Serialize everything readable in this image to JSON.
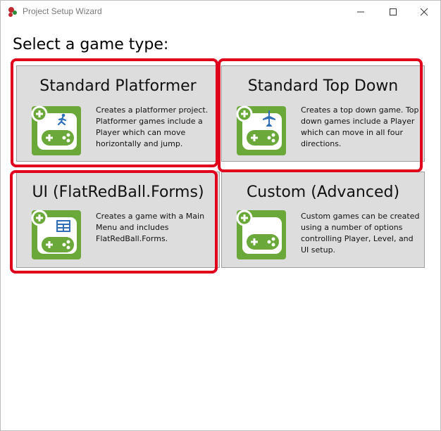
{
  "window": {
    "title": "Project Setup Wizard"
  },
  "prompt": "Select a game type:",
  "cards": [
    {
      "title": "Standard Platformer",
      "description": "Creates a platformer project. Platformer games include a Player which can move horizontally and jump.",
      "icon": "platformer-runner-icon",
      "highlighted": true
    },
    {
      "title": "Standard Top Down",
      "description": "Creates a top down game. Top down games include a Player which can move in all four directions.",
      "icon": "top-down-airplane-icon",
      "highlighted": true
    },
    {
      "title": "UI (FlatRedBall.Forms)",
      "description": "Creates a game with a Main Menu and includes FlatRedBall.Forms.",
      "icon": "ui-forms-icon",
      "highlighted": true
    },
    {
      "title": "Custom (Advanced)",
      "description": "Custom games can be created using a number of options controlling Player, Level, and UI setup.",
      "icon": "gamepad-icon",
      "highlighted": false
    }
  ],
  "colors": {
    "icon_green": "#6ba83a",
    "highlight_red": "#e0001b",
    "card_bg": "#dddddd",
    "icon_blue": "#2e6fb8"
  }
}
